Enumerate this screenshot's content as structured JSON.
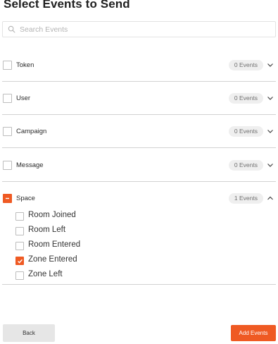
{
  "page": {
    "title": "Select Events to Send"
  },
  "search": {
    "placeholder": "Search Events",
    "icon": "search-icon"
  },
  "groups": [
    {
      "label": "Token",
      "badge": "0 Events",
      "checked": false,
      "expanded": false
    },
    {
      "label": "User",
      "badge": "0 Events",
      "checked": false,
      "expanded": false
    },
    {
      "label": "Campaign",
      "badge": "0 Events",
      "checked": false,
      "expanded": false
    },
    {
      "label": "Message",
      "badge": "0 Events",
      "checked": false,
      "expanded": false
    },
    {
      "label": "Space",
      "badge": "1 Events",
      "checked": "partial",
      "expanded": true,
      "events": [
        {
          "label": "Room Joined",
          "checked": false
        },
        {
          "label": "Room Left",
          "checked": false
        },
        {
          "label": "Room Entered",
          "checked": false
        },
        {
          "label": "Zone Entered",
          "checked": true
        },
        {
          "label": "Zone Left",
          "checked": false
        }
      ]
    }
  ],
  "footer": {
    "back_label": "Back",
    "add_label": "Add Events"
  },
  "colors": {
    "accent": "#ef5a23",
    "badge_bg": "#efefef",
    "divider": "#d2d2d2"
  }
}
